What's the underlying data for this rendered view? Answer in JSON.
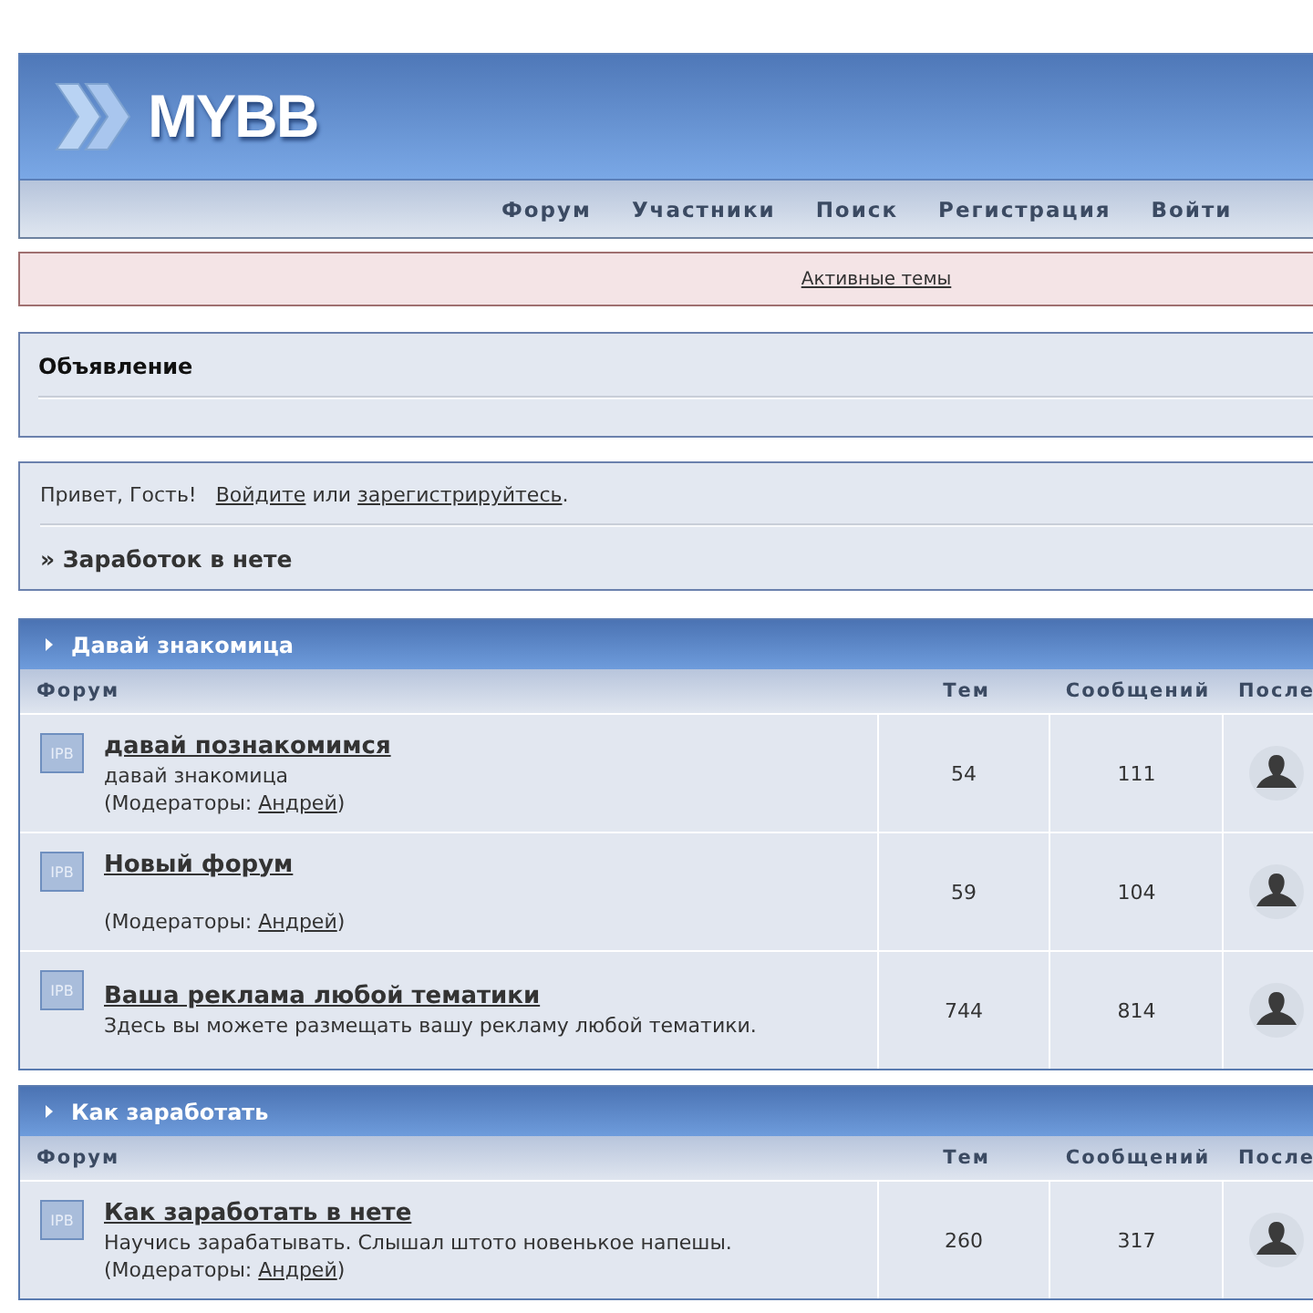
{
  "logo": {
    "text": "MYBB"
  },
  "nav": [
    {
      "label": "Форум"
    },
    {
      "label": "Участники"
    },
    {
      "label": "Поиск"
    },
    {
      "label": "Регистрация"
    },
    {
      "label": "Войти"
    }
  ],
  "notice_bar": {
    "link": "Активные темы"
  },
  "announcement": {
    "title": "Объявление"
  },
  "welcome": {
    "greeting": "Привет, Гость!",
    "login_link": "Войдите",
    "or_text": "или",
    "register_link": "зарегистрируйтесь",
    "end": ".",
    "breadcrumb": "» Заработок в нете"
  },
  "categories": [
    {
      "title": "Давай знакомица",
      "columns": [
        "Форум",
        "Тем",
        "Сообщений",
        "После"
      ],
      "forums": [
        {
          "icon_label": "IPB",
          "name": "давай познакомимся",
          "description": "давай знакомица",
          "moderators_prefix": "(Модераторы:",
          "moderator": "Андрей",
          "moderators_suffix": ")",
          "topics": "54",
          "posts": "111"
        },
        {
          "icon_label": "IPB",
          "name": "Новый форум",
          "moderators_prefix": "(Модераторы:",
          "moderator": "Андрей",
          "moderators_suffix": ")",
          "topics": "59",
          "posts": "104"
        },
        {
          "icon_label": "IPB",
          "name": "Ваша реклама любой тематики",
          "description": "Здесь вы можете размещать вашу рекламу любой тематики.",
          "topics": "744",
          "posts": "814"
        }
      ]
    },
    {
      "title": "Как заработать",
      "columns": [
        "Форум",
        "Тем",
        "Сообщений",
        "После"
      ],
      "forums": [
        {
          "icon_label": "IPB",
          "name": "Как заработать в нете",
          "description": "Научись зарабатывать. Слышал штото новенькое напешы.",
          "moderators_prefix": "(Модераторы:",
          "moderator": "Андрей",
          "moderators_suffix": ")",
          "topics": "260",
          "posts": "317"
        }
      ]
    }
  ]
}
